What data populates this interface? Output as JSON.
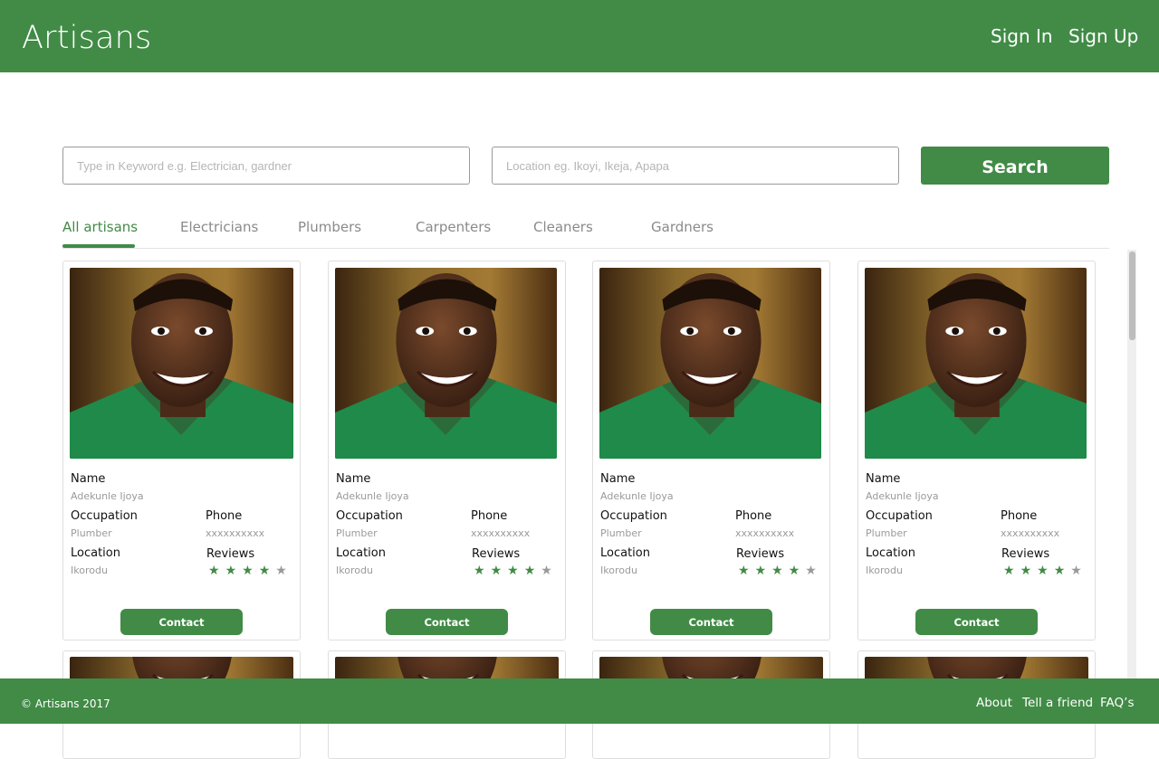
{
  "header": {
    "brand": "Artisans",
    "sign_in": "Sign In",
    "sign_up": "Sign Up"
  },
  "search": {
    "keyword_placeholder": "Type in Keyword e.g. Electrician, gardner",
    "location_placeholder": "Location eg. Ikoyi, Ikeja, Apapa",
    "button_label": "Search"
  },
  "tabs": [
    {
      "label": "All artisans",
      "active": true
    },
    {
      "label": "Electricians",
      "active": false
    },
    {
      "label": "Plumbers",
      "active": false
    },
    {
      "label": "Carpenters",
      "active": false
    },
    {
      "label": "Cleaners",
      "active": false
    },
    {
      "label": "Gardners",
      "active": false
    }
  ],
  "card_labels": {
    "name": "Name",
    "occupation": "Occupation",
    "phone": "Phone",
    "location": "Location",
    "reviews": "Reviews",
    "contact": "Contact"
  },
  "cards": [
    {
      "name": "Adekunle Ijoya",
      "occupation": "Plumber",
      "phone": "xxxxxxxxxx",
      "location": "Ikorodu",
      "rating": 4,
      "max_rating": 5
    },
    {
      "name": "Adekunle Ijoya",
      "occupation": "Plumber",
      "phone": "xxxxxxxxxx",
      "location": "Ikorodu",
      "rating": 4,
      "max_rating": 5
    },
    {
      "name": "Adekunle Ijoya",
      "occupation": "Plumber",
      "phone": "xxxxxxxxxx",
      "location": "Ikorodu",
      "rating": 4,
      "max_rating": 5
    },
    {
      "name": "Adekunle Ijoya",
      "occupation": "Plumber",
      "phone": "xxxxxxxxxx",
      "location": "Ikorodu",
      "rating": 4,
      "max_rating": 5
    }
  ],
  "footer": {
    "copyright": "© Artisans 2017",
    "links": [
      "About",
      "Tell a friend",
      "FAQ’s"
    ]
  },
  "colors": {
    "brand_green": "#418b46",
    "star_on": "#418b46",
    "star_off": "#9a9a9a"
  },
  "icons": [
    "star-icon",
    "artisan-photo"
  ]
}
